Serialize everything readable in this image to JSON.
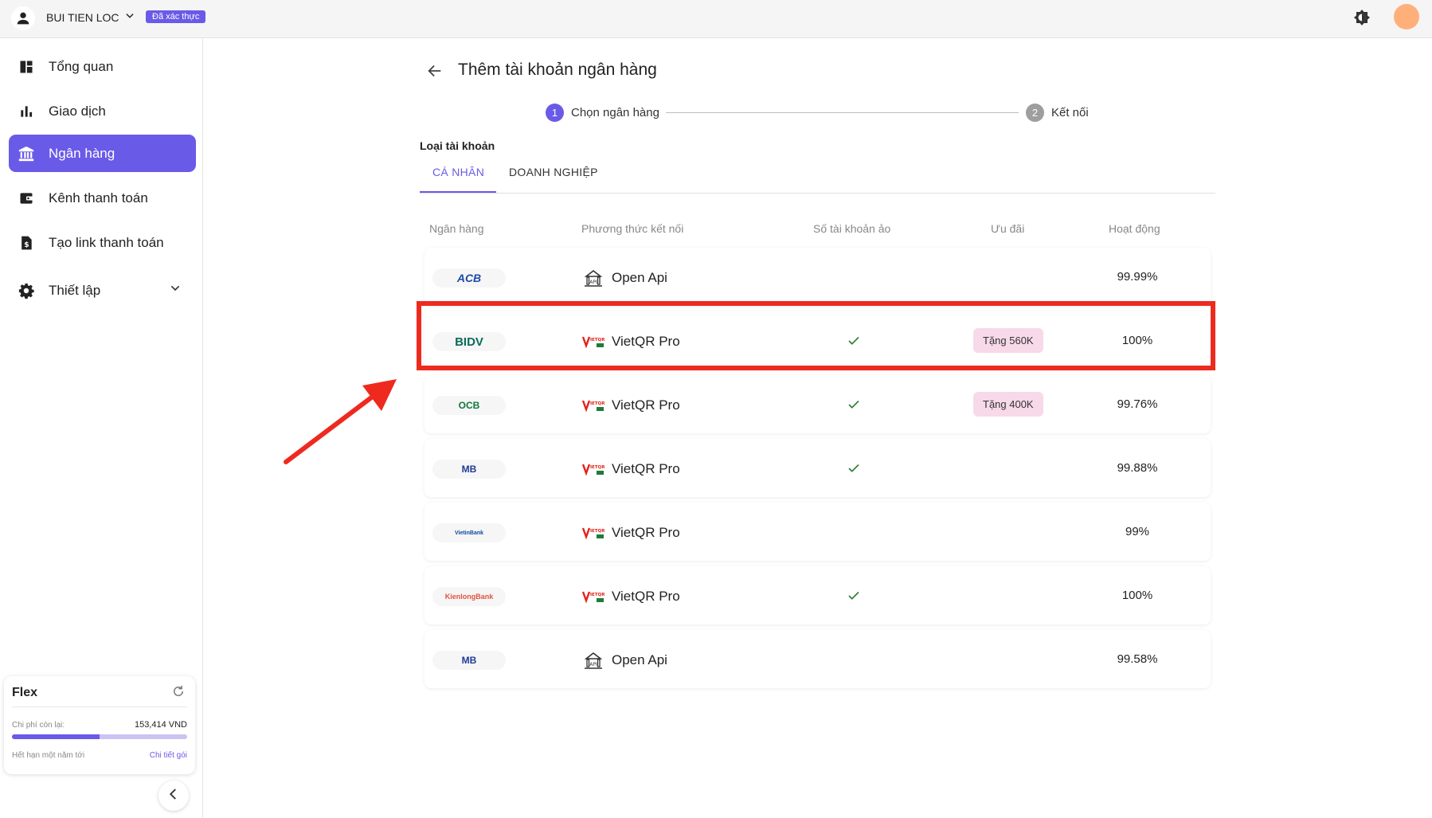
{
  "topbar": {
    "username": "BUI TIEN LOC",
    "verified_badge": "Đã xác thực",
    "avatar_color": "#ffb07a",
    "accent_color": "#6a5ae8"
  },
  "sidebar": {
    "items": [
      {
        "label": "Tổng quan",
        "icon": "dashboard-icon"
      },
      {
        "label": "Giao dịch",
        "icon": "bar-chart-icon"
      },
      {
        "label": "Ngân hàng",
        "icon": "bank-icon",
        "active": true
      },
      {
        "label": "Kênh thanh toán",
        "icon": "wallet-icon"
      },
      {
        "label": "Tạo link thanh toán",
        "icon": "invoice-icon"
      },
      {
        "label": "Thiết lập",
        "icon": "gear-icon",
        "expandable": true
      }
    ],
    "plan": {
      "name": "Flex",
      "remaining_label": "Chi phí còn lại:",
      "remaining_amount": "153,414 VND",
      "progress_fraction": 0.5,
      "expiry_text": "Hết hạn một năm tới",
      "detail_link": "Chi tiết gói"
    }
  },
  "main": {
    "title": "Thêm tài khoản ngân hàng",
    "steps": [
      {
        "number": "1",
        "label": "Chọn ngân hàng",
        "active": true
      },
      {
        "number": "2",
        "label": "Kết nối",
        "active": false
      }
    ],
    "account_type_label": "Loại tài khoản",
    "tabs": [
      {
        "label": "CÁ NHÂN",
        "active": true
      },
      {
        "label": "DOANH NGHIỆP",
        "active": false
      }
    ],
    "table": {
      "headers": [
        "Ngân hàng",
        "Phương thức kết nối",
        "Số tài khoản ảo",
        "Ưu đãi",
        "Hoạt động"
      ],
      "rows": [
        {
          "bank": "ACB",
          "method": "Open Api",
          "method_icon": "open-api-icon",
          "virtual_account": false,
          "promo": "",
          "uptime": "99.99%"
        },
        {
          "bank": "BIDV",
          "method": "VietQR Pro",
          "method_icon": "vietqr-icon",
          "virtual_account": true,
          "promo": "Tặng 560K",
          "uptime": "100%"
        },
        {
          "bank": "OCB",
          "method": "VietQR Pro",
          "method_icon": "vietqr-icon",
          "virtual_account": true,
          "promo": "Tặng 400K",
          "uptime": "99.76%"
        },
        {
          "bank": "MB",
          "method": "VietQR Pro",
          "method_icon": "vietqr-icon",
          "virtual_account": true,
          "promo": "",
          "uptime": "99.88%"
        },
        {
          "bank": "VietinBank",
          "method": "VietQR Pro",
          "method_icon": "vietqr-icon",
          "virtual_account": false,
          "promo": "",
          "uptime": "99%"
        },
        {
          "bank": "KienlongBank",
          "method": "VietQR Pro",
          "method_icon": "vietqr-icon",
          "virtual_account": true,
          "promo": "",
          "uptime": "100%"
        },
        {
          "bank": "MB",
          "method": "Open Api",
          "method_icon": "open-api-icon",
          "virtual_account": false,
          "promo": "",
          "uptime": "99.58%"
        }
      ]
    },
    "annotation_color": "#ee2a1f"
  }
}
